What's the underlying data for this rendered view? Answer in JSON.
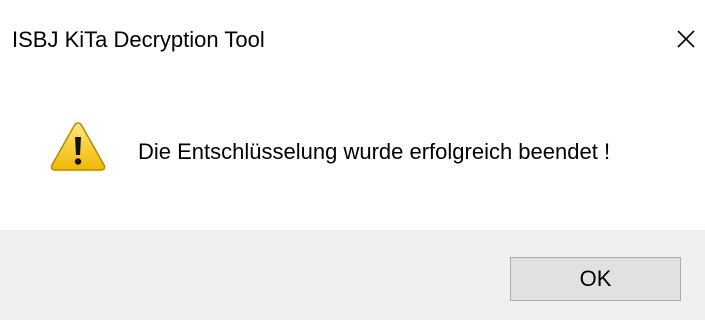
{
  "window": {
    "title": "ISBJ KiTa Decryption Tool",
    "close_icon": "close-icon"
  },
  "message": {
    "icon": "warning-icon",
    "text": "Die Entschlüsselung wurde erfolgreich beendet !"
  },
  "buttons": {
    "ok_label": "OK"
  },
  "colors": {
    "dialog_bg": "#ffffff",
    "footer_bg": "#f0f0f0",
    "button_bg": "#e1e1e1",
    "button_border": "#adadad",
    "warning_fill": "#f7c51f",
    "warning_mark": "#000000"
  }
}
